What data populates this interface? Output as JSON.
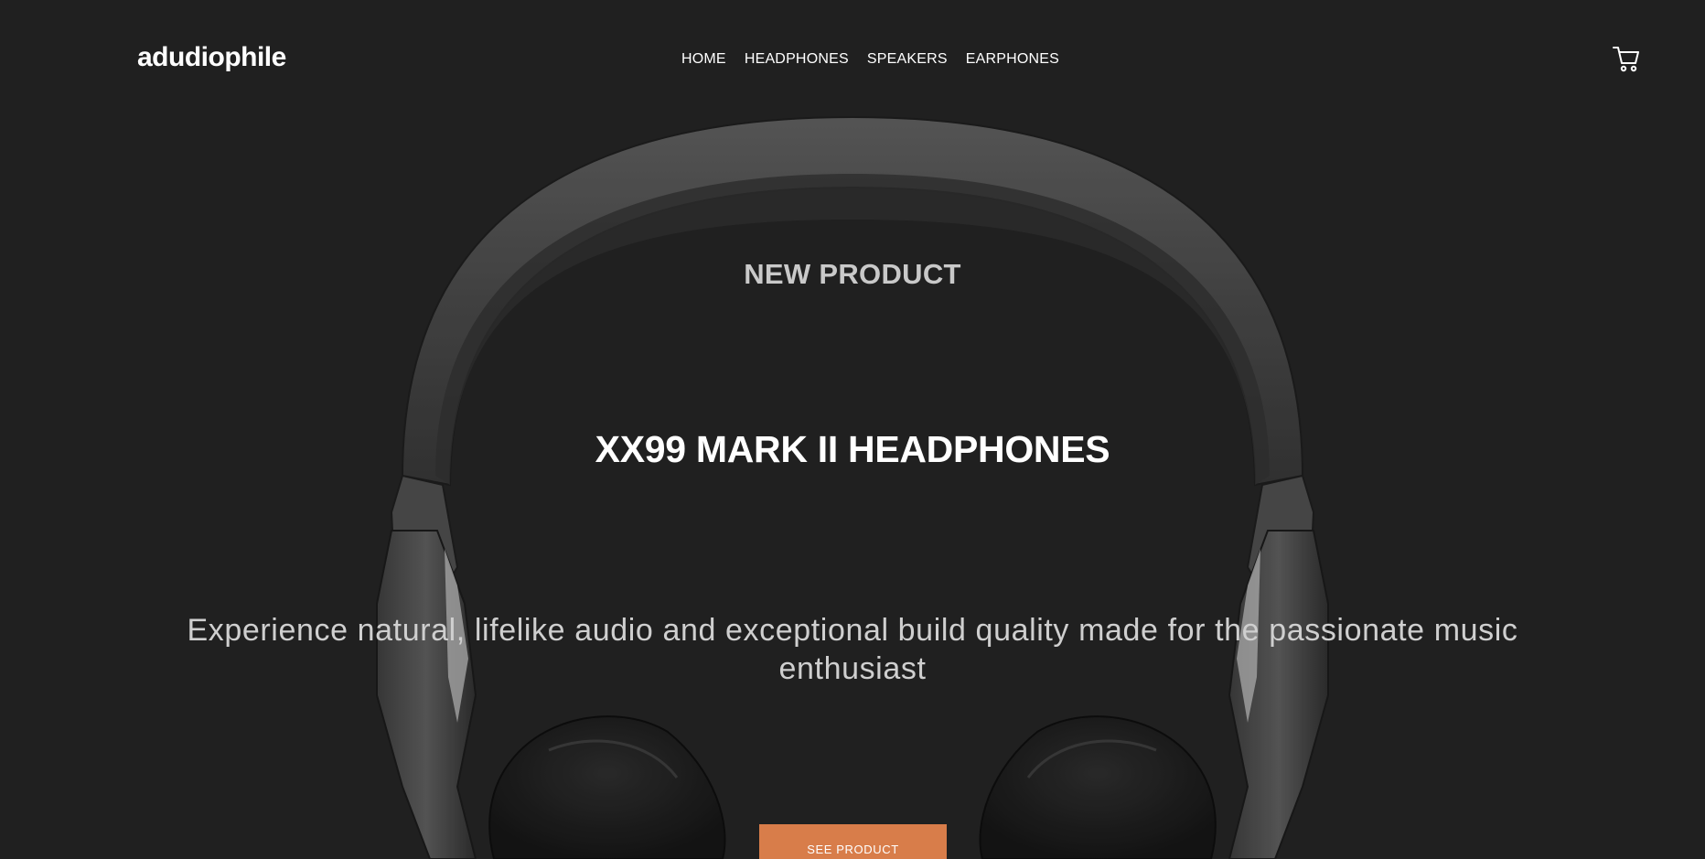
{
  "brand": {
    "logo_text": "adudiophile"
  },
  "nav": {
    "items": [
      {
        "label": "HOME"
      },
      {
        "label": "HEADPHONES"
      },
      {
        "label": "SPEAKERS"
      },
      {
        "label": "EARPHONES"
      }
    ]
  },
  "header": {
    "cart_icon": "cart-icon"
  },
  "hero": {
    "overline": "NEW PRODUCT",
    "title": "XX99 MARK II HEADPHONES",
    "description": "Experience natural, lifelike audio and exceptional build quality made for the passionate music enthusiast",
    "cta_label": "SEE PRODUCT"
  },
  "colors": {
    "background": "#202020",
    "accent": "#d87d4a",
    "text_primary": "#ffffff",
    "text_muted": "#cfcfcf"
  }
}
